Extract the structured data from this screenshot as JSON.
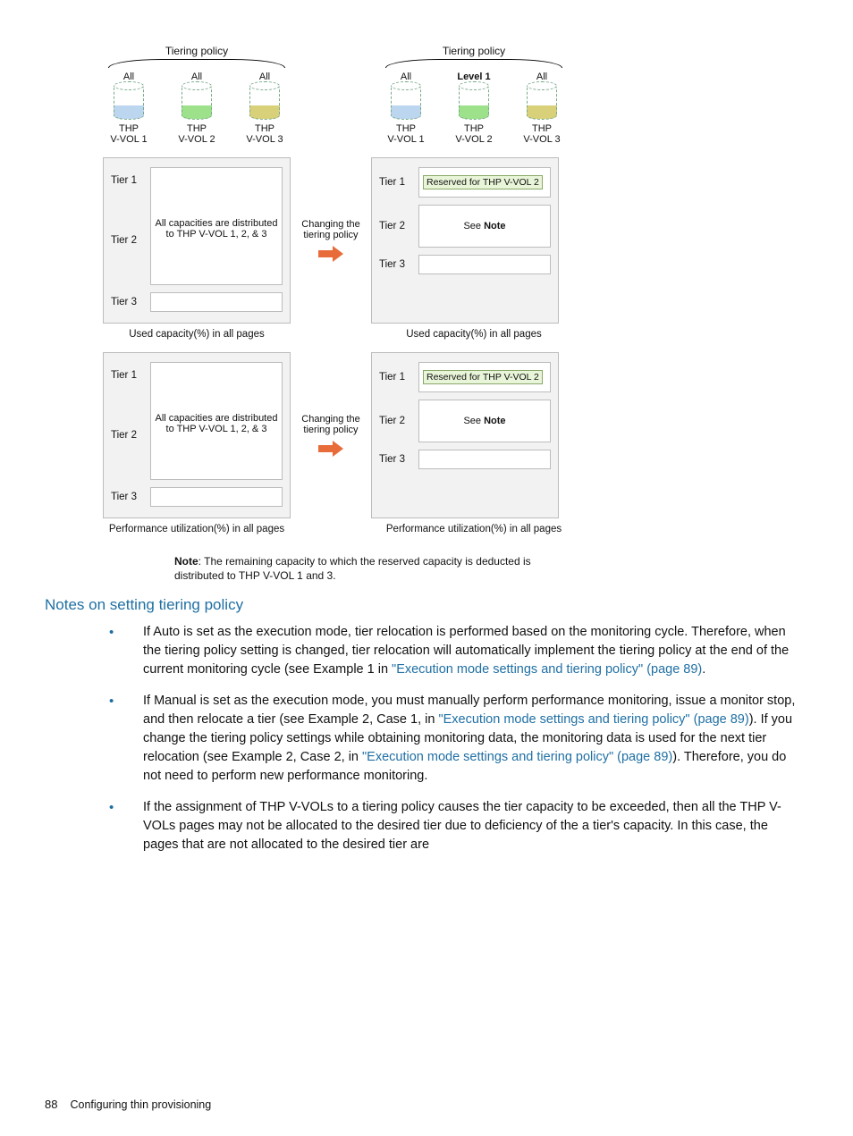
{
  "diagram": {
    "leftPolicyTitle": "Tiering policy",
    "rightPolicyTitle": "Tiering policy",
    "leftVols": [
      {
        "policy": "All",
        "name": "THP\nV-VOL 1"
      },
      {
        "policy": "All",
        "name": "THP\nV-VOL 2"
      },
      {
        "policy": "All",
        "name": "THP\nV-VOL 3"
      }
    ],
    "rightVols": [
      {
        "policy": "All",
        "name": "THP\nV-VOL 1"
      },
      {
        "policy": "Level 1",
        "name": "THP\nV-VOL 2",
        "bold": true
      },
      {
        "policy": "All",
        "name": "THP\nV-VOL 3"
      }
    ],
    "tierLabels": [
      "Tier 1",
      "Tier 2",
      "Tier 3"
    ],
    "distributedText": "All capacities are distributed to THP V-VOL 1, 2, & 3",
    "changingText": "Changing the tiering policy",
    "reservedText": "Reserved for THP V-VOL 2",
    "seeNoteText": "See Note",
    "caption1Left": "Used capacity(%) in all pages",
    "caption1Right": "Used capacity(%) in all pages",
    "caption2Left": "Performance utilization(%) in all pages",
    "caption2Right": "Performance utilization(%) in all pages",
    "noteLabel": "Note",
    "noteText": ": The remaining capacity to which the reserved capacity is deducted is distributed to THP V-VOL 1 and 3."
  },
  "section": {
    "heading": "Notes on setting tiering policy",
    "items": [
      {
        "pre": "If Auto is set as the execution mode, tier relocation is performed based on the monitoring cycle. Therefore, when the tiering policy setting is changed, tier relocation will automatically implement the tiering policy at the end of the current monitoring cycle (see Example 1 in ",
        "link1": "\"Execution mode settings and tiering policy\" (page 89)",
        "post": "."
      },
      {
        "pre": "If Manual is set as the execution mode, you must manually perform performance monitoring, issue a monitor stop, and then relocate a tier (see Example 2, Case 1, in ",
        "link1": "\"Execution mode settings and tiering policy\" (page 89)",
        "mid": "). If you change the tiering policy settings while obtaining monitoring data, the monitoring data is used for the next tier relocation (see Example 2, Case 2, in ",
        "link2": "\"Execution mode settings and tiering policy\" (page 89)",
        "post": "). Therefore, you do not need to perform new performance monitoring."
      },
      {
        "pre": "If the assignment of THP V-VOLs to a tiering policy causes the tier capacity to be exceeded, then all the THP V-VOLs pages may not be allocated to the desired tier due to deficiency of the a tier's capacity. In this case, the pages that are not allocated to the desired tier are"
      }
    ]
  },
  "footer": {
    "pageNumber": "88",
    "chapterTitle": "Configuring thin provisioning"
  }
}
